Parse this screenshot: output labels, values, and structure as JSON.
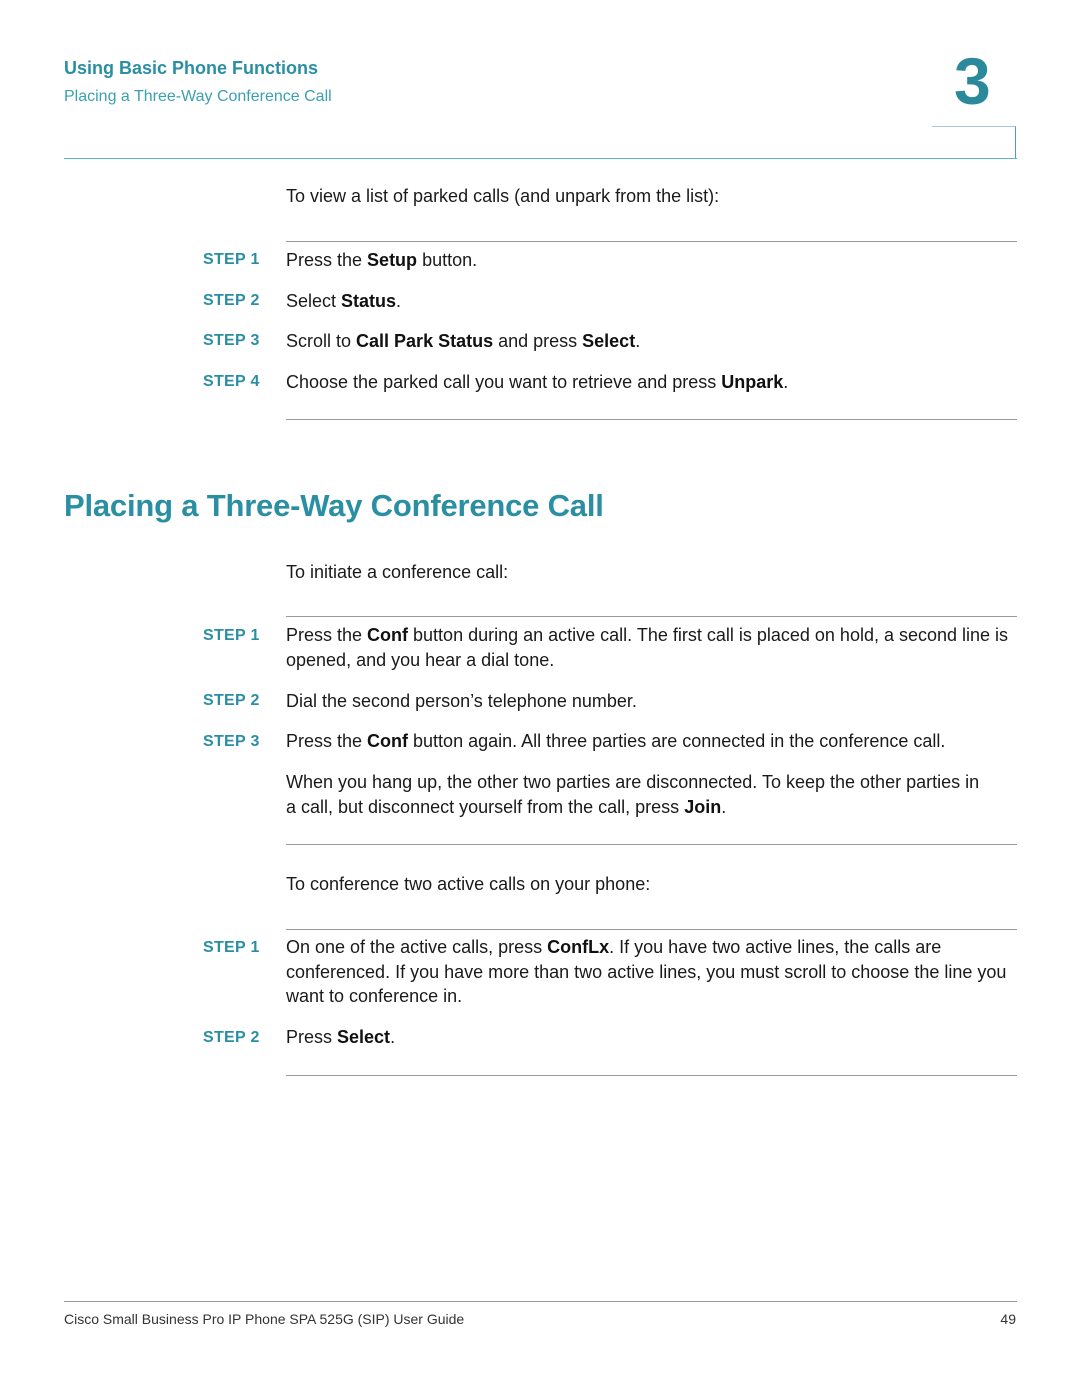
{
  "header": {
    "chapter_title": "Using Basic Phone Functions",
    "section_title": "Placing a Three-Way Conference Call",
    "chapter_number": "3"
  },
  "park_section": {
    "intro": "To view a list of parked calls (and unpark from the list):",
    "steps": [
      {
        "label": "STEP 1",
        "parts": [
          {
            "t": "Press the "
          },
          {
            "b": "Setup"
          },
          {
            "t": " button."
          }
        ]
      },
      {
        "label": "STEP 2",
        "parts": [
          {
            "t": "Select "
          },
          {
            "b": "Status"
          },
          {
            "t": "."
          }
        ]
      },
      {
        "label": "STEP 3",
        "parts": [
          {
            "t": "Scroll to "
          },
          {
            "b": "Call Park Status"
          },
          {
            "t": " and press "
          },
          {
            "b": "Select"
          },
          {
            "t": "."
          }
        ]
      },
      {
        "label": "STEP 4",
        "parts": [
          {
            "t": "Choose the parked call you want to retrieve and press "
          },
          {
            "b": "Unpark"
          },
          {
            "t": "."
          }
        ]
      }
    ]
  },
  "conference_section": {
    "title": "Placing a Three-Way Conference Call",
    "intro": "To initiate a conference call:",
    "steps": [
      {
        "label": "STEP 1",
        "parts": [
          {
            "t": "Press the "
          },
          {
            "b": "Conf"
          },
          {
            "t": " button during an active call. The first call is placed on hold, a second line is opened, and you hear a dial tone."
          }
        ]
      },
      {
        "label": "STEP 2",
        "parts": [
          {
            "t": "Dial the second person’s telephone number."
          }
        ]
      },
      {
        "label": "STEP 3",
        "parts": [
          {
            "t": "Press the "
          },
          {
            "b": "Conf"
          },
          {
            "t": " button again. All three parties are connected in the conference call."
          }
        ]
      }
    ],
    "note_parts": [
      {
        "t": "When you hang up, the other two parties are disconnected. To keep the other parties in a call, but disconnect yourself from the call, press "
      },
      {
        "b": "Join"
      },
      {
        "t": "."
      }
    ],
    "intro2": "To conference two active calls on your phone:",
    "steps2": [
      {
        "label": "STEP 1",
        "parts": [
          {
            "t": "On one of the active calls, press "
          },
          {
            "b": "ConfLx"
          },
          {
            "t": ". If you have two active lines, the calls are conferenced. If you have more than two active lines, you must scroll to choose the line you want to conference in."
          }
        ]
      },
      {
        "label": "STEP 2",
        "parts": [
          {
            "t": "Press "
          },
          {
            "b": "Select"
          },
          {
            "t": "."
          }
        ]
      }
    ]
  },
  "footer": {
    "guide_title": "Cisco Small Business Pro IP Phone SPA 525G (SIP) User Guide",
    "page_number": "49"
  }
}
